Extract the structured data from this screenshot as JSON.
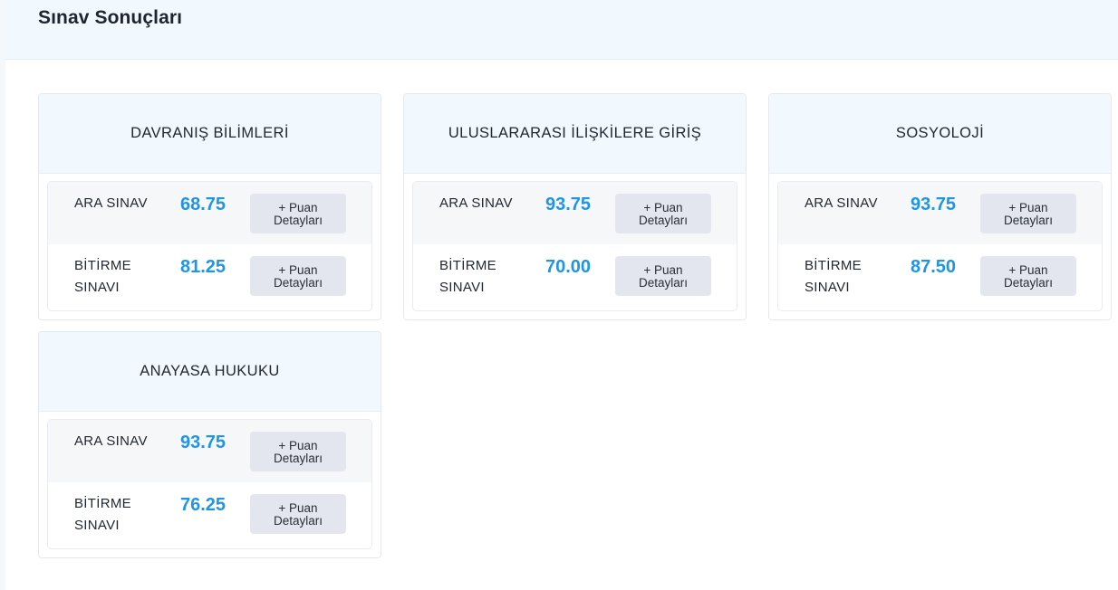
{
  "page": {
    "title": "Sınav Sonuçları"
  },
  "colors": {
    "score": "#1f95e5",
    "header_bg": "#f1f8fe",
    "button_bg": "#e3e6ee"
  },
  "courses": [
    {
      "title": "DAVRANIŞ BİLİMLERİ",
      "exams": [
        {
          "name": "ARA SINAV",
          "score": "68.75",
          "button_line1": "+ Puan",
          "button_line2": "Detayları"
        },
        {
          "name": "BİTİRME SINAVI",
          "score": "81.25",
          "button_line1": "+ Puan",
          "button_line2": "Detayları"
        }
      ]
    },
    {
      "title": "ULUSLARARASI İLİŞKİLERE GİRİŞ",
      "exams": [
        {
          "name": "ARA SINAV",
          "score": "93.75",
          "button_line1": "+ Puan",
          "button_line2": "Detayları"
        },
        {
          "name": "BİTİRME SINAVI",
          "score": "70.00",
          "button_line1": "+ Puan",
          "button_line2": "Detayları"
        }
      ]
    },
    {
      "title": "SOSYOLOJİ",
      "exams": [
        {
          "name": "ARA SINAV",
          "score": "93.75",
          "button_line1": "+ Puan",
          "button_line2": "Detayları"
        },
        {
          "name": "BİTİRME SINAVI",
          "score": "87.50",
          "button_line1": "+ Puan",
          "button_line2": "Detayları"
        }
      ]
    },
    {
      "title": "ANAYASA HUKUKU",
      "exams": [
        {
          "name": "ARA SINAV",
          "score": "93.75",
          "button_line1": "+ Puan",
          "button_line2": "Detayları"
        },
        {
          "name": "BİTİRME SINAVI",
          "score": "76.25",
          "button_line1": "+ Puan",
          "button_line2": "Detayları"
        }
      ]
    }
  ]
}
